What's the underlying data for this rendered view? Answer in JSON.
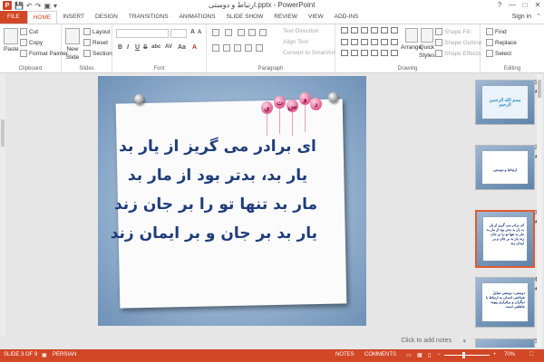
{
  "window": {
    "title": "ارتباط و دوستی.pptx - PowerPoint",
    "help": "?",
    "minimize": "—",
    "restore": "□",
    "close": "✕"
  },
  "qat": {
    "logo": "P",
    "save": "💾",
    "undo": "↶",
    "redo": "↷",
    "start": "▣",
    "more": "▾"
  },
  "tabs": [
    "FILE",
    "HOME",
    "INSERT",
    "DESIGN",
    "TRANSITIONS",
    "ANIMATIONS",
    "SLIDE SHOW",
    "REVIEW",
    "VIEW",
    "ADD-INS"
  ],
  "active_tab": "HOME",
  "signin": "Sign in",
  "ribbon": {
    "clipboard": {
      "paste": "Paste",
      "cut": "Cut",
      "copy": "Copy",
      "format_painter": "Format Painter",
      "label": "Clipboard"
    },
    "slides": {
      "new_slide": "New",
      "new_slide2": "Slide",
      "layout": "Layout",
      "reset": "Reset",
      "section": "Section",
      "label": "Slides"
    },
    "font": {
      "bold": "B",
      "italic": "I",
      "underline": "U",
      "strike": "S",
      "shadow": "abc",
      "spacing": "AV",
      "case": "Aa",
      "color": "A",
      "label": "Font"
    },
    "paragraph": {
      "text_direction": "Text Direction",
      "align_text": "Align Text",
      "smartart": "Convert to SmartArt",
      "label": "Paragraph"
    },
    "drawing": {
      "arrange": "Arrange",
      "quick_styles": "Quick",
      "quick_styles2": "Styles",
      "shape_fill": "Shape Fill",
      "shape_outline": "Shape Outline",
      "shape_effects": "Shape Effects",
      "label": "Drawing"
    },
    "editing": {
      "find": "Find",
      "replace": "Replace",
      "select": "Select",
      "label": "Editing"
    }
  },
  "slide": {
    "title_letters": [
      "د",
      "و",
      "س",
      "ت",
      "ی"
    ],
    "lines": [
      "ای برادر می گریز از یار بد",
      "یار بد، بدتر بود از مار بد",
      "مار بد تنها تو را بر جان زند",
      "یار بد بر جان و بر ایمان زند"
    ]
  },
  "thumbnails": [
    {
      "num": "1",
      "star": "★",
      "text": "بسم الله الرحمن الرحیم"
    },
    {
      "num": "2",
      "star": "★",
      "text": "ارتباط و دوستی"
    },
    {
      "num": "3",
      "star": "★",
      "text": "ای برادر می گریز از یار بد یار بد بدتر بود از مار بد مار بد تنها تو را بر جان زند یار بد بر جان و بر ایمان زند"
    },
    {
      "num": "4",
      "star": "★",
      "text": "دوستی: دوستی تمایل شناختی انسان به ارتباط با دیگران و برقراری پیوند عاطفی است"
    },
    {
      "num": "5",
      "star": "",
      "text": ""
    }
  ],
  "notes": "Click to add notes",
  "status": {
    "slide_of": "SLIDE 3 OF 9",
    "language": "PERSIAN",
    "notes": "NOTES",
    "comments": "COMMENTS",
    "zoom": "70%"
  }
}
